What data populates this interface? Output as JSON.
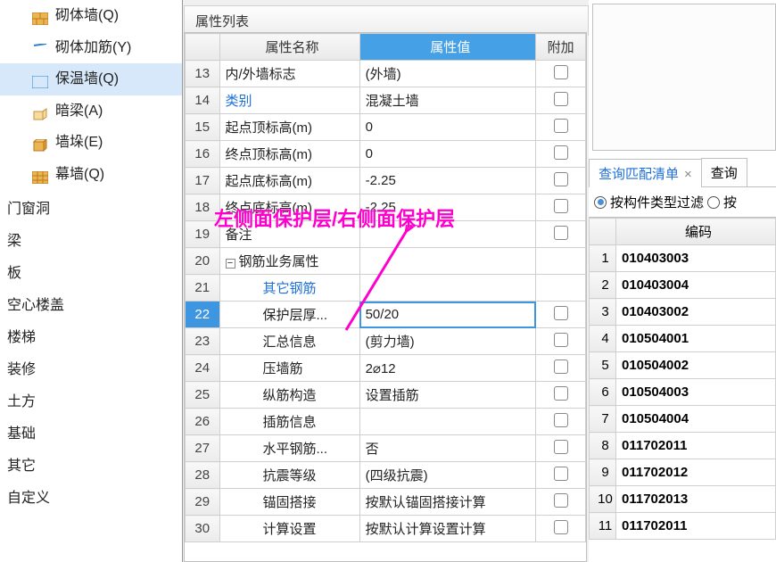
{
  "sidebar": {
    "items_top": [
      {
        "label": "砌体墙(Q)",
        "icon": "brick"
      },
      {
        "label": "砌体加筋(Y)",
        "icon": "bars-blue"
      },
      {
        "label": "保温墙(Q)",
        "icon": "hatch",
        "selected": true
      },
      {
        "label": "暗梁(A)",
        "icon": "box3d"
      },
      {
        "label": "墙垛(E)",
        "icon": "cube"
      },
      {
        "label": "幕墙(Q)",
        "icon": "tiles"
      }
    ],
    "items_cat": [
      "门窗洞",
      "梁",
      "板",
      "空心楼盖",
      "楼梯",
      "装修",
      "土方",
      "基础",
      "其它",
      "自定义"
    ]
  },
  "prop": {
    "panel_title": "属性列表",
    "headers": {
      "name": "属性名称",
      "value": "属性值",
      "extra": "附加"
    },
    "rows": [
      {
        "n": 13,
        "name": "内/外墙标志",
        "val": "(外墙)",
        "chk": true
      },
      {
        "n": 14,
        "name": "类别",
        "val": "混凝土墙",
        "chk": true,
        "name_link": true
      },
      {
        "n": 15,
        "name": "起点顶标高(m)",
        "val": "0",
        "chk": true
      },
      {
        "n": 16,
        "name": "终点顶标高(m)",
        "val": "0",
        "chk": true
      },
      {
        "n": 17,
        "name": "起点底标高(m)",
        "val": "-2.25",
        "chk": true
      },
      {
        "n": 18,
        "name": "终点底标高(m)",
        "val": "-2.25",
        "chk": true
      },
      {
        "n": 19,
        "name": "备注",
        "val": "",
        "chk": true
      },
      {
        "n": 20,
        "name": "钢筋业务属性",
        "val": "",
        "tree": true
      },
      {
        "n": 21,
        "name": "其它钢筋",
        "val": "",
        "indent": 2,
        "name_link": true
      },
      {
        "n": 22,
        "name": "保护层厚...",
        "val": "50/20",
        "indent": 2,
        "chk": true,
        "selected": true
      },
      {
        "n": 23,
        "name": "汇总信息",
        "val": "(剪力墙)",
        "indent": 2,
        "chk": true
      },
      {
        "n": 24,
        "name": "压墙筋",
        "val": "2⌀12",
        "indent": 2,
        "chk": true
      },
      {
        "n": 25,
        "name": "纵筋构造",
        "val": "设置插筋",
        "indent": 2,
        "chk": true
      },
      {
        "n": 26,
        "name": "插筋信息",
        "val": "",
        "indent": 2,
        "chk": true
      },
      {
        "n": 27,
        "name": "水平钢筋...",
        "val": "否",
        "indent": 2,
        "chk": true
      },
      {
        "n": 28,
        "name": "抗震等级",
        "val": "(四级抗震)",
        "indent": 2,
        "chk": true
      },
      {
        "n": 29,
        "name": "锚固搭接",
        "val": "按默认锚固搭接计算",
        "indent": 2,
        "chk": true
      },
      {
        "n": 30,
        "name": "计算设置",
        "val": "按默认计算设置计算",
        "indent": 2,
        "chk": true
      }
    ]
  },
  "right": {
    "tabs": [
      {
        "label": "查询匹配清单",
        "active": true,
        "closable": true
      },
      {
        "label": "查询"
      }
    ],
    "filter_options": [
      {
        "label": "按构件类型过滤",
        "checked": true
      },
      {
        "label": "按"
      }
    ],
    "code_header": "编码",
    "codes": [
      "010403003",
      "010403004",
      "010403002",
      "010504001",
      "010504002",
      "010504003",
      "010504004",
      "011702011",
      "011702012",
      "011702013",
      "011702011"
    ]
  },
  "annot": {
    "text": "左侧面保护层/右侧面保护层"
  }
}
